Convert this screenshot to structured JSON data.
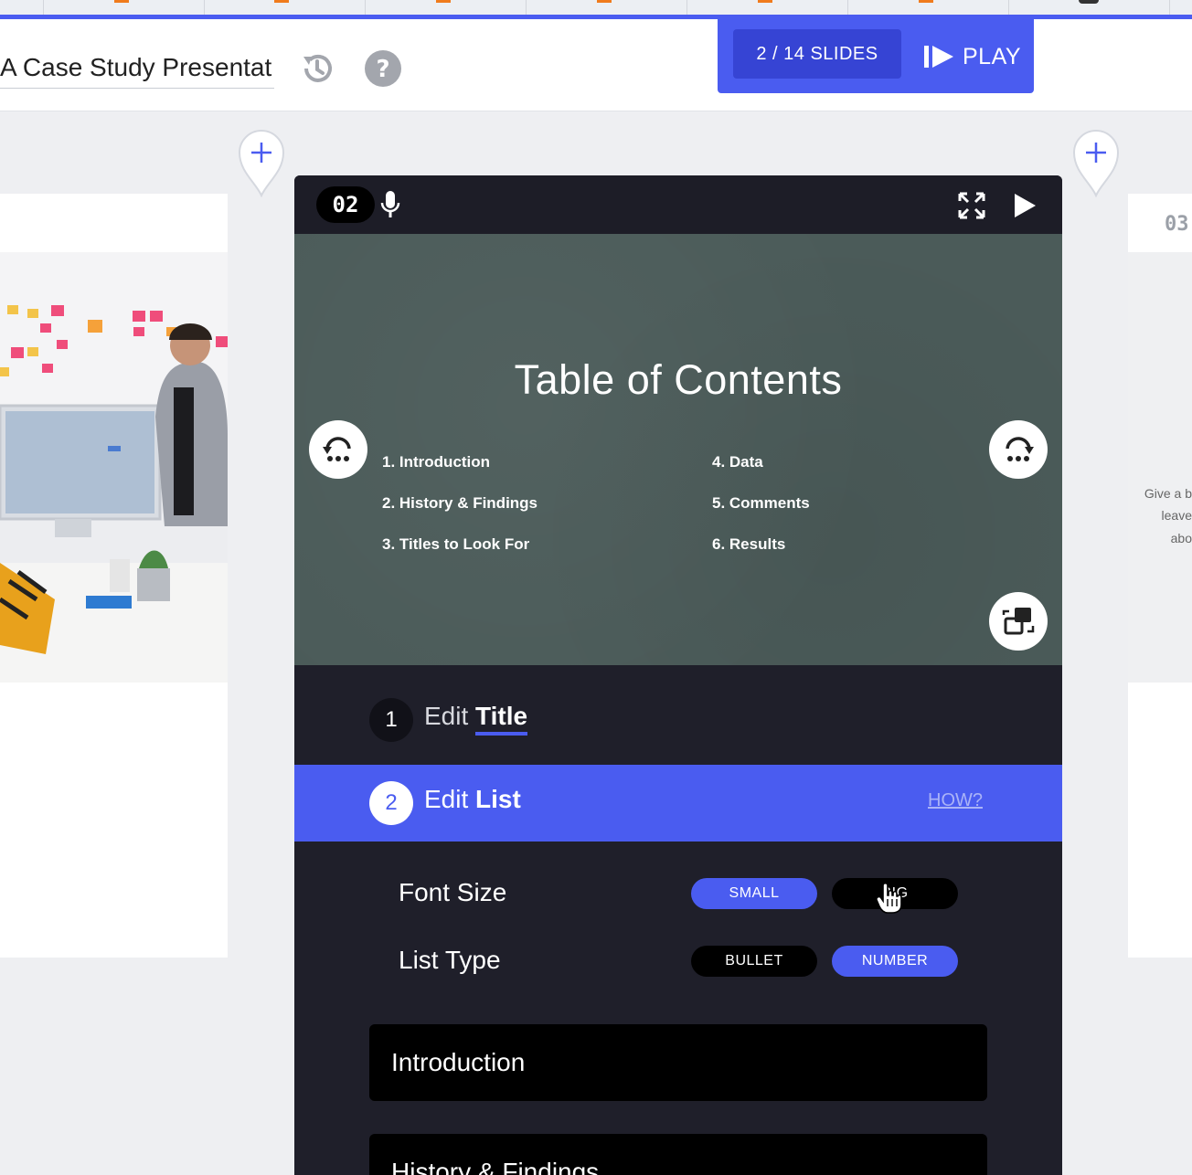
{
  "header": {
    "presentation_title": "A Case Study Presentat",
    "slides_counter": "2 / 14 SLIDES",
    "play_label": "PLAY"
  },
  "slide": {
    "number": "02",
    "title": "Table of Contents",
    "items": [
      "1.  Introduction",
      "2.  History & Findings",
      "3.  Titles to Look For",
      "4.  Data",
      "5.  Comments",
      "6.  Results"
    ]
  },
  "next_slide": {
    "number": "03",
    "text_lines": [
      "Give a b",
      "leave",
      "abo"
    ]
  },
  "steps": {
    "step1": {
      "num": "1",
      "prefix": "Edit",
      "bold": "Title"
    },
    "step2": {
      "num": "2",
      "prefix": "Edit",
      "bold": "List",
      "help": "HOW?"
    }
  },
  "options": {
    "font_size_label": "Font Size",
    "font_small": "SMALL",
    "font_big": "BIG",
    "list_type_label": "List Type",
    "list_bullet": "BULLET",
    "list_number": "NUMBER"
  },
  "list_fields": [
    "Introduction",
    "History & Findings"
  ],
  "colors": {
    "accent": "#4a5cf0",
    "dark": "#1f1f2a",
    "slide_bg": "#4b5b59",
    "tick": "#f07b1c"
  }
}
